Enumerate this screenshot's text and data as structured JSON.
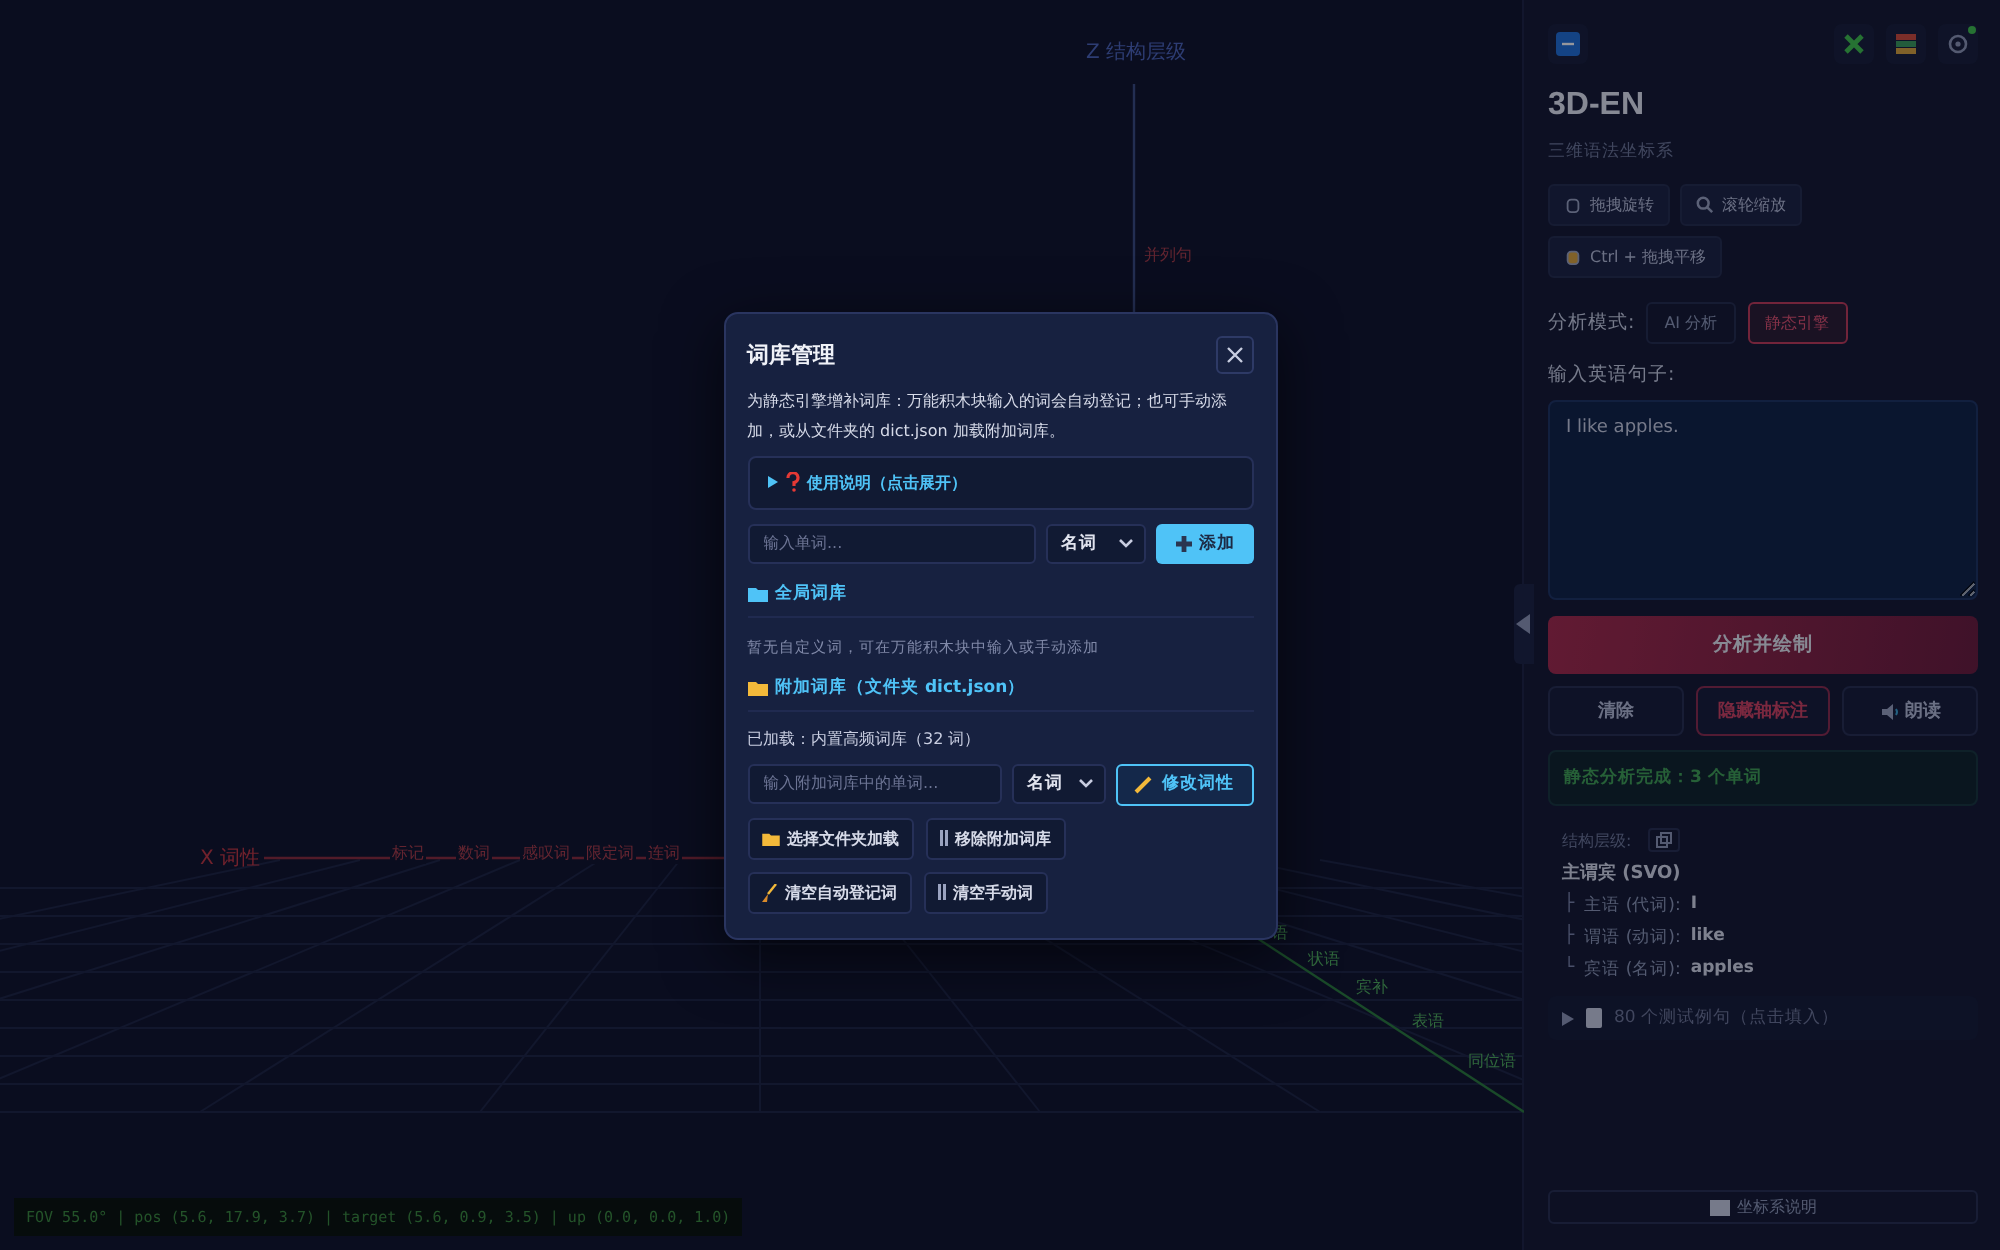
{
  "scene": {
    "z_axis_label": "Z 结构层级",
    "z_tick": "并列句",
    "x_axis_label": "X 词性",
    "x_ticks": [
      "标记",
      "数词",
      "感叹词",
      "限定词",
      "连词"
    ],
    "y_ticks": [
      "语",
      "状语",
      "宾补",
      "表语",
      "同位语"
    ],
    "status": "FOV 55.0° | pos (5.6, 17.9, 3.7) | target (5.6, 0.9, 3.5) | up (0.0, 0.0, 1.0)"
  },
  "sidebar": {
    "title": "3D-EN",
    "subtitle": "三维语法坐标系",
    "hints": [
      "拖拽旋转",
      "滚轮缩放",
      "Ctrl + 拖拽平移"
    ],
    "mode_label": "分析模式:",
    "modes": [
      {
        "label": "AI 分析",
        "selected": false
      },
      {
        "label": "静态引擎",
        "selected": true
      }
    ],
    "input_label": "输入英语句子:",
    "sentence": "I like apples.",
    "analyze": "分析并绘制",
    "actions": [
      {
        "label": "清除",
        "kind": "plain"
      },
      {
        "label": "隐藏轴标注",
        "kind": "danger"
      },
      {
        "label": "朗读",
        "kind": "speak"
      }
    ],
    "result": "静态分析完成：3 个单词",
    "structure_label": "结构层级:",
    "structure": "主谓宾 (SVO)",
    "parts": [
      {
        "branch": "├",
        "role": "主语 (代词):",
        "word": "I"
      },
      {
        "branch": "├",
        "role": "谓语 (动词):",
        "word": "like"
      },
      {
        "branch": "└",
        "role": "宾语 (名词):",
        "word": "apples"
      }
    ],
    "examples": "80 个测试例句（点击填入）",
    "guide": "坐标系说明"
  },
  "dialog": {
    "title": "词库管理",
    "description": "为静态引擎增补词库：万能积木块输入的词会自动登记；也可手动添加，或从文件夹的 dict.json 加载附加词库。",
    "help": "使用说明（点击展开）",
    "word_input": {
      "placeholder": "输入单词..."
    },
    "word_type": "名词",
    "add": "添加",
    "global_section": "全局词库",
    "global_empty": "暂无自定义词，可在万能积木块中输入或手动添加",
    "extra_section": "附加词库（文件夹 dict.json）",
    "loaded": "已加载：内置高频词库（32 词）",
    "extra_input": {
      "placeholder": "输入附加词库中的单词..."
    },
    "extra_type": "名词",
    "modify": "修改词性",
    "buttons": [
      {
        "label": "选择文件夹加载",
        "kind": "folder"
      },
      {
        "label": "移除附加词库",
        "kind": "bin"
      },
      {
        "label": "清空自动登记词",
        "kind": "broom"
      },
      {
        "label": "清空手动词",
        "kind": "bin"
      }
    ]
  }
}
